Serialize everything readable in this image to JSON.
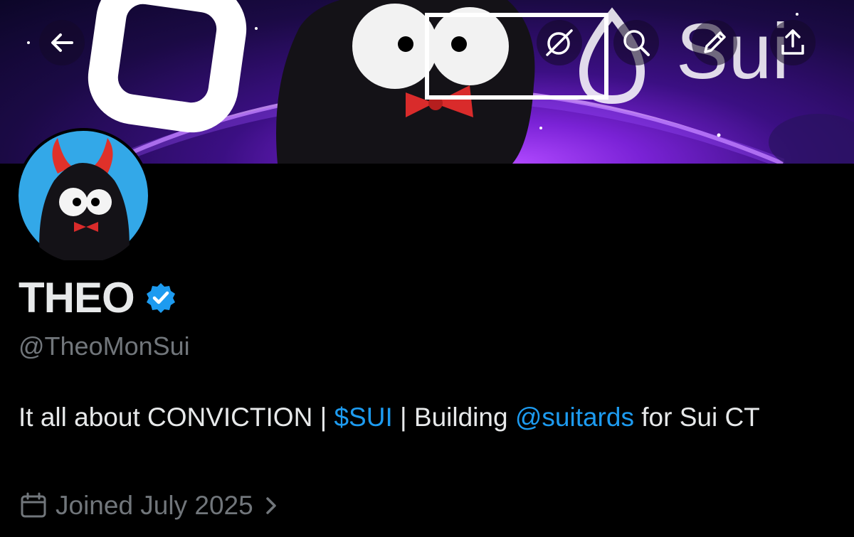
{
  "banner": {
    "brand_text": "Sui"
  },
  "toolbar": {
    "icons": [
      "back-arrow-icon",
      "grok-icon",
      "search-icon",
      "edit-pencil-icon",
      "share-icon"
    ]
  },
  "profile": {
    "name": "THEO",
    "handle": "@TheoMonSui",
    "bio": {
      "part1": "It all about CONVICTION | ",
      "cashtag": "$SUI",
      "part2": " | Building ",
      "mention": "@suitards",
      "part3": " for Sui CT"
    },
    "joined": "Joined July 2025"
  },
  "colors": {
    "link": "#1d9bf0",
    "verified": "#1d9bf0",
    "muted": "#71767b",
    "text": "#e7e9ea"
  }
}
